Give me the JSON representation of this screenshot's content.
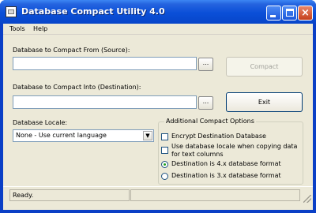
{
  "window": {
    "title": "Database Compact Utility 4.0",
    "controls": {
      "minimize": "",
      "maximize": "",
      "close": "×"
    }
  },
  "menu": {
    "items": [
      "Tools",
      "Help"
    ]
  },
  "source": {
    "label": "Database to Compact From (Source):",
    "value": "",
    "browse_label": "..."
  },
  "destination": {
    "label": "Database to Compact Into (Destination):",
    "value": "",
    "browse_label": "..."
  },
  "buttons": {
    "compact": "Compact",
    "exit": "Exit"
  },
  "locale": {
    "label": "Database Locale:",
    "selected": "None - Use current language",
    "arrow": "▼"
  },
  "options": {
    "title": "Additional Compact Options",
    "encrypt": {
      "label": "Encrypt Destination Database",
      "checked": false
    },
    "use_locale": {
      "label_line1": "Use database locale when copying data",
      "label_line2": "for text columns",
      "checked": false
    },
    "format4": {
      "label": "Destination is 4.x database format",
      "selected": true
    },
    "format3": {
      "label": "Destination is 3.x database format",
      "selected": false
    }
  },
  "status": {
    "text": "Ready.",
    "pane2": ""
  },
  "colors": {
    "titlebar": "#0a4fd8",
    "client": "#ece9d8",
    "radio_dot": "#21a121",
    "close_button": "#c5401c"
  }
}
